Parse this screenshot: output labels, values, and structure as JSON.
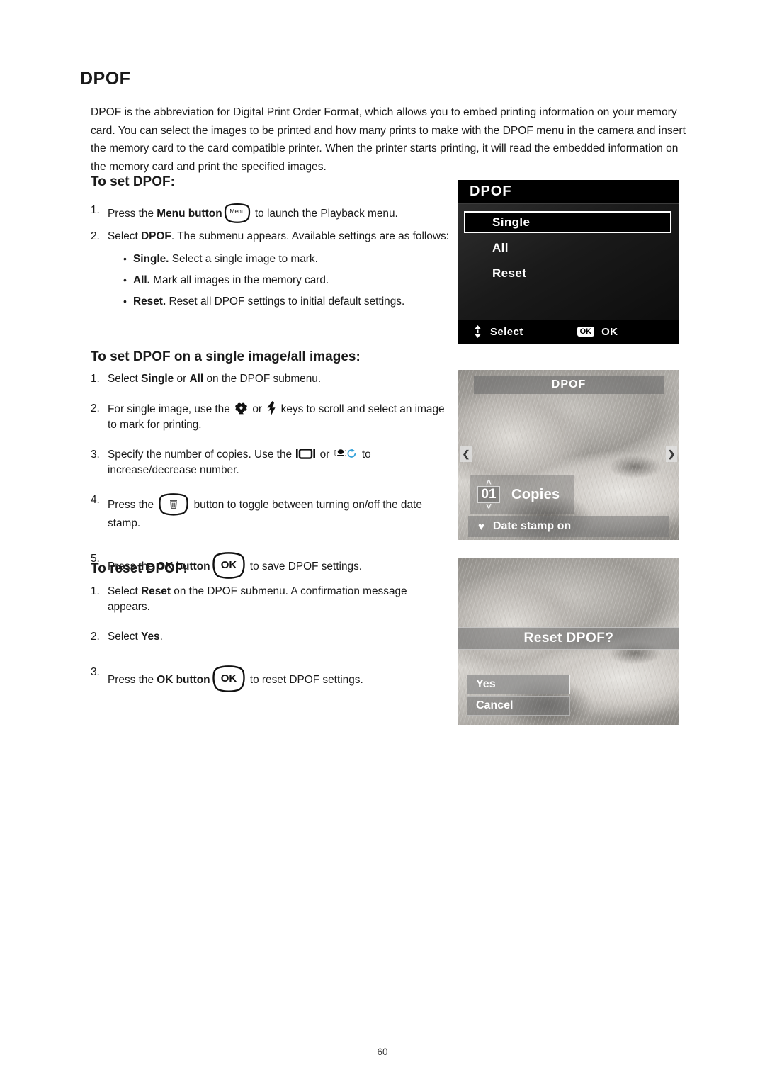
{
  "document": {
    "heading": "DPOF",
    "intro": "DPOF is the abbreviation for Digital Print Order Format, which allows you to embed printing information on your memory card. You can select the images to be printed and how many prints to make with the DPOF menu in the camera and insert the memory card to the card compatible printer. When the printer starts printing, it will read the embedded information on the memory card and print the specified images.",
    "page_number": "60"
  },
  "section_set": {
    "heading": "To set DPOF:",
    "steps": [
      {
        "num": "1.",
        "before": "Press the ",
        "bold": "Menu button",
        "icon": "menu-button-icon",
        "after": " to launch the Playback menu."
      },
      {
        "num": "2.",
        "before": "Select ",
        "bold": "DPOF",
        "after": ". The submenu appears. Available settings are as follows:"
      }
    ],
    "settings": [
      {
        "bullet": "•",
        "term": "Single.",
        "desc": " Select a single image to mark."
      },
      {
        "bullet": "•",
        "term": "All.",
        "desc": " Mark all images in the memory card."
      },
      {
        "bullet": "•",
        "term": "Reset.",
        "desc": " Reset all DPOF settings to initial default settings."
      }
    ]
  },
  "section_single": {
    "heading": "To set DPOF on a single image/all images:",
    "steps": [
      {
        "num": "1.",
        "t1": "Select ",
        "b1": "Single",
        "t2": " or ",
        "b2": "All",
        "t3": " on the DPOF submenu."
      },
      {
        "num": "2.",
        "t1": "For single image, use the ",
        "icon1": "macro-flower-icon",
        "t2": " or ",
        "icon2": "flash-bolt-icon",
        "t3": " keys to scroll and select an image to mark for printing."
      },
      {
        "num": "3.",
        "t1": "Specify the number of copies. Use the ",
        "icon1": "display-icon",
        "t2": " or ",
        "icon2": "self-timer-icon",
        "t3": " to increase/decrease number."
      },
      {
        "num": "4.",
        "t1": "Press the ",
        "icon1": "delete-button-icon",
        "t3": " button to toggle between turning on/off the date stamp."
      },
      {
        "num": "5.",
        "t1": "Press the ",
        "b1": "OK button",
        "icon1": "ok-button-icon",
        "t3": " to save DPOF settings."
      }
    ]
  },
  "section_reset": {
    "heading": "To reset DPOF:",
    "steps": [
      {
        "num": "1.",
        "t1": "Select ",
        "b1": "Reset",
        "t3": " on the DPOF submenu. A confirmation message appears."
      },
      {
        "num": "2.",
        "t1": "Select ",
        "b1": "Yes",
        "t3": "."
      },
      {
        "num": "3.",
        "t1": "Press the ",
        "b1": "OK button",
        "icon1": "ok-button-icon",
        "t3": " to reset DPOF settings."
      }
    ]
  },
  "screens": {
    "menu": {
      "title": "DPOF",
      "items": [
        {
          "label": "Single",
          "selected": true
        },
        {
          "label": "All",
          "selected": false
        },
        {
          "label": "Reset",
          "selected": false
        }
      ],
      "footer": {
        "updown_icon": "up-down-arrow-icon",
        "select_label": "Select",
        "ok_badge": "OK",
        "ok_label": "OK"
      }
    },
    "copies": {
      "title": "DPOF",
      "prev_arrow": "❮",
      "next_arrow": "❯",
      "up_caret": "˄",
      "down_caret": "˅",
      "count": "01",
      "count_label": "Copies",
      "heart_icon": "♥",
      "date_stamp_label": "Date stamp on"
    },
    "reset": {
      "banner": "Reset DPOF?",
      "options": [
        {
          "label": "Yes",
          "selected": true
        },
        {
          "label": "Cancel",
          "selected": false
        }
      ]
    }
  },
  "colors": {
    "ink": "#1a1a1a",
    "screen_bg": "#000000",
    "accent_blue": "#2f9fd8"
  }
}
